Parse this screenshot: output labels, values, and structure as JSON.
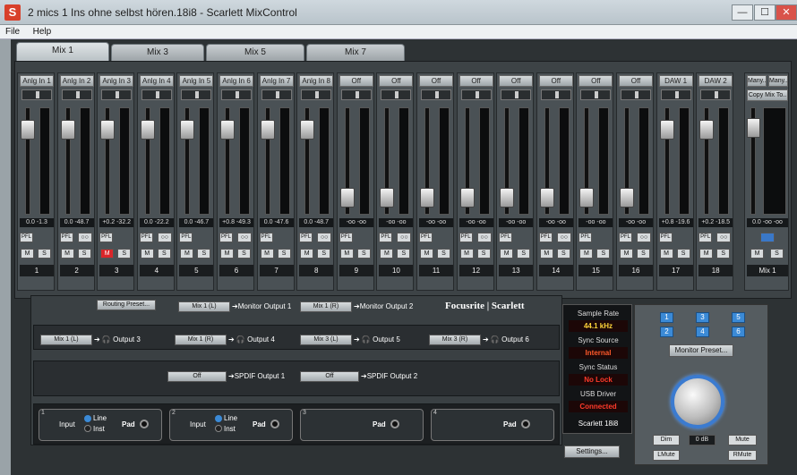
{
  "window": {
    "title": "2 mics 1 Ins ohne selbst hören.18i8 - Scarlett MixControl",
    "min": "—",
    "max": "☐",
    "close": "✕"
  },
  "menu": [
    "File",
    "Help"
  ],
  "tabs": [
    "Mix 1",
    "Mix 3",
    "Mix 5",
    "Mix 7"
  ],
  "channels": [
    {
      "src": "Anlg In 1",
      "vals": "0.0  -1.3",
      "pfl": "PFL",
      "num": "1",
      "m": "M",
      "s": "S"
    },
    {
      "src": "Anlg In 2",
      "vals": "0.0  -48.7",
      "pfl": "PFL",
      "num": "2",
      "m": "M",
      "s": "S"
    },
    {
      "src": "Anlg In 3",
      "vals": "+0.2  -32.2",
      "pfl": "PFL",
      "num": "3",
      "m": "M",
      "s": "S"
    },
    {
      "src": "Anlg In 4",
      "vals": "0.0  -22.2",
      "pfl": "PFL",
      "num": "4",
      "m": "M",
      "s": "S"
    },
    {
      "src": "Anlg In 5",
      "vals": "0.0  -46.7",
      "pfl": "PFL",
      "num": "5",
      "m": "M",
      "s": "S"
    },
    {
      "src": "Anlg In 6",
      "vals": "+0.8  -49.3",
      "pfl": "PFL",
      "num": "6",
      "m": "M",
      "s": "S"
    },
    {
      "src": "Anlg In 7",
      "vals": "0.0  -47.6",
      "pfl": "PFL",
      "num": "7",
      "m": "M",
      "s": "S"
    },
    {
      "src": "Anlg In 8",
      "vals": "0.0  -48.7",
      "pfl": "PFL",
      "num": "8",
      "m": "M",
      "s": "S"
    },
    {
      "src": "Off",
      "vals": "-oo  -oo",
      "pfl": "PFL",
      "num": "9",
      "m": "M",
      "s": "S"
    },
    {
      "src": "Off",
      "vals": "-oo  -oo",
      "pfl": "PFL",
      "num": "10",
      "m": "M",
      "s": "S"
    },
    {
      "src": "Off",
      "vals": "-oo  -oo",
      "pfl": "PFL",
      "num": "11",
      "m": "M",
      "s": "S"
    },
    {
      "src": "Off",
      "vals": "-oo  -oo",
      "pfl": "PFL",
      "num": "12",
      "m": "M",
      "s": "S"
    },
    {
      "src": "Off",
      "vals": "-oo  -oo",
      "pfl": "PFL",
      "num": "13",
      "m": "M",
      "s": "S"
    },
    {
      "src": "Off",
      "vals": "-oo  -oo",
      "pfl": "PFL",
      "num": "14",
      "m": "M",
      "s": "S"
    },
    {
      "src": "Off",
      "vals": "-oo  -oo",
      "pfl": "PFL",
      "num": "15",
      "m": "M",
      "s": "S"
    },
    {
      "src": "Off",
      "vals": "-oo  -oo",
      "pfl": "PFL",
      "num": "16",
      "m": "M",
      "s": "S"
    },
    {
      "src": "DAW 1",
      "vals": "+0.8  -19.6",
      "pfl": "PFL",
      "num": "17",
      "m": "M",
      "s": "S"
    },
    {
      "src": "DAW 2",
      "vals": "+0.2  -18.5",
      "pfl": "PFL",
      "num": "18",
      "m": "M",
      "s": "S"
    }
  ],
  "mix_channel": {
    "many_l": "Many..",
    "many_r": "Many..",
    "copy": "Copy Mix To..",
    "vals": "0.0  -oo  -oo",
    "num": "Mix 1",
    "m": "M",
    "s": "S"
  },
  "routing": {
    "preset": "Routing Preset...",
    "mon1_src": "Mix 1 (L)",
    "mon1_label": "Monitor Output 1",
    "mon2_src": "Mix 1 (R)",
    "mon2_label": "Monitor Output 2",
    "brand_a": "Focusrite",
    "brand_b": "Scarlett",
    "o3_src": "Mix 1 (L)",
    "o3_label": "Output 3",
    "o4_src": "Mix 1 (R)",
    "o4_label": "Output 4",
    "o5_src": "Mix 3 (L)",
    "o5_label": "Output 5",
    "o6_src": "Mix 3 (R)",
    "o6_label": "Output 6",
    "spdif1_src": "Off",
    "spdif1_label": "SPDIF Output 1",
    "spdif2_src": "Off",
    "spdif2_label": "SPDIF Output 2"
  },
  "inputs": [
    {
      "num": "1",
      "input": "Input",
      "line": "Line",
      "inst": "Inst",
      "pad": "Pad"
    },
    {
      "num": "2",
      "input": "Input",
      "line": "Line",
      "inst": "Inst",
      "pad": "Pad"
    },
    {
      "num": "3",
      "pad": "Pad"
    },
    {
      "num": "4",
      "pad": "Pad"
    }
  ],
  "status": {
    "sample_rate_label": "Sample Rate",
    "sample_rate": "44.1 kHz",
    "sync_source_label": "Sync Source",
    "sync_source": "Internal",
    "sync_status_label": "Sync Status",
    "sync_status": "No Lock",
    "usb_label": "USB Driver",
    "usb": "Connected",
    "device": "Scarlett 18i8",
    "settings": "Settings..."
  },
  "monitor": {
    "buttons": [
      "1",
      "2",
      "3",
      "4",
      "5",
      "6"
    ],
    "preset": "Monitor Preset...",
    "level": "0 dB",
    "dim": "Dim",
    "mute": "Mute",
    "lmute": "LMute",
    "rmute": "RMute"
  },
  "colors": {
    "accent": "#3b8ad6",
    "alert": "#ff3a2a",
    "value_green": "#e6e6e6"
  },
  "fader_levels": [
    0.86,
    0.86,
    0.86,
    0.86,
    0.86,
    0.86,
    0.86,
    0.86,
    0.08,
    0.08,
    0.08,
    0.08,
    0.08,
    0.08,
    0.08,
    0.08,
    0.86,
    0.86
  ]
}
